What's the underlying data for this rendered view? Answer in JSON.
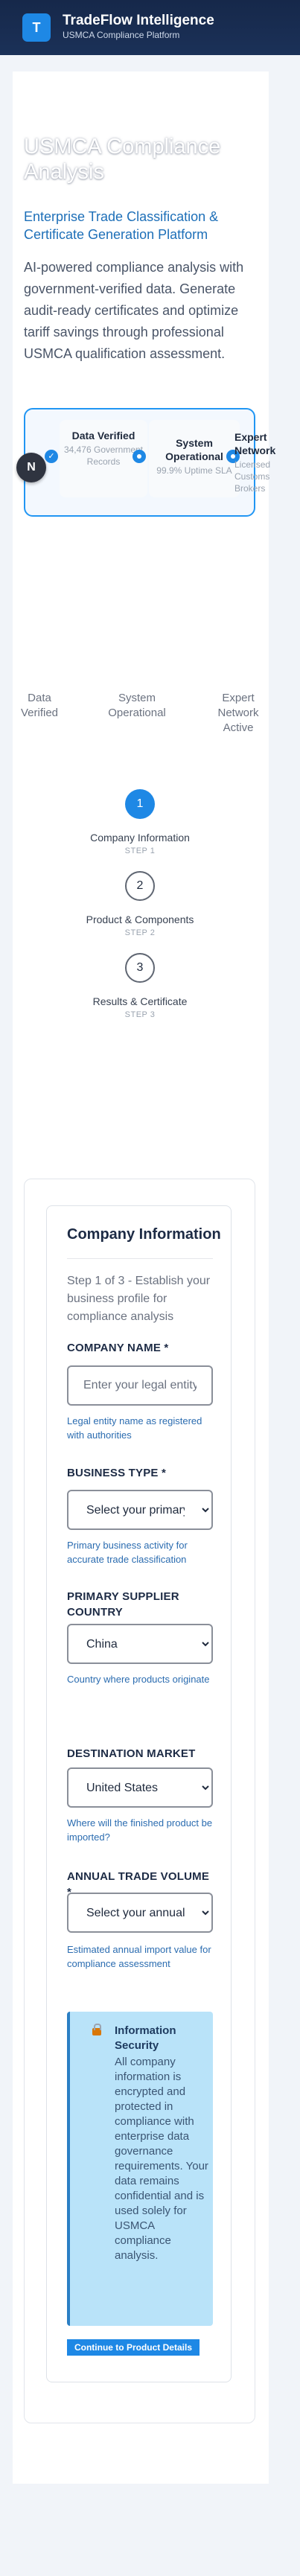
{
  "header": {
    "logo_letter": "T",
    "title": "TradeFlow Intelligence",
    "subtitle": "USMCA Compliance Platform"
  },
  "hero": {
    "title": "USMCA Compliance Analysis",
    "subtitle": "Enterprise Trade Classification & Certificate Generation Platform",
    "description": "AI-powered compliance analysis with government-verified data. Generate audit-ready certificates and optimize tariff savings through professional USMCA qualification assessment."
  },
  "stats": {
    "badge": "N",
    "items": [
      {
        "title": "Data Verified",
        "sub": "34,476 Government Records"
      },
      {
        "title": "System Operational",
        "sub": "99.9% Uptime SLA"
      },
      {
        "title": "Expert Network",
        "sub": "Licensed Customs Brokers"
      }
    ]
  },
  "status_row": [
    "Data Verified",
    "System Operational",
    "Expert Network Active"
  ],
  "steps": [
    {
      "number": "1",
      "name": "Company Information",
      "tag": "STEP 1",
      "state": "active"
    },
    {
      "number": "2",
      "name": "Product & Components",
      "tag": "STEP 2",
      "state": "todo"
    },
    {
      "number": "3",
      "name": "Results & Certificate",
      "tag": "STEP 3",
      "state": "todo"
    }
  ],
  "form": {
    "title": "Company Information",
    "intro": "Step 1 of 3 - Establish your business profile for compliance analysis",
    "company_name": {
      "label": "COMPANY NAME *",
      "placeholder": "Enter your legal entity name",
      "help": "Legal entity name as registered with authorities"
    },
    "business_type": {
      "label": "BUSINESS TYPE *",
      "value": "Select your primary business type",
      "help": "Primary business activity for accurate trade classification"
    },
    "supplier_country": {
      "label": "PRIMARY SUPPLIER COUNTRY",
      "value": "China",
      "help": "Country where products originate"
    },
    "destination_market": {
      "label": "DESTINATION MARKET",
      "value": "United States",
      "help": "Where will the finished product be imported?"
    },
    "trade_volume": {
      "label": "ANNUAL TRADE VOLUME *",
      "value": "Select your annual trade volume",
      "help": "Estimated annual import value for compliance assessment"
    },
    "security": {
      "title": "Information Security",
      "body": "All company information is encrypted and protected in compliance with enterprise data governance requirements. Your data remains confidential and is used solely for USMCA compliance analysis."
    },
    "continue_label": "Continue to Product Details"
  },
  "colors": {
    "header_bg": "#16284a",
    "accent": "#1e88e5",
    "help_text": "#2b6cb0",
    "security_bg": "#b9e3f9"
  }
}
